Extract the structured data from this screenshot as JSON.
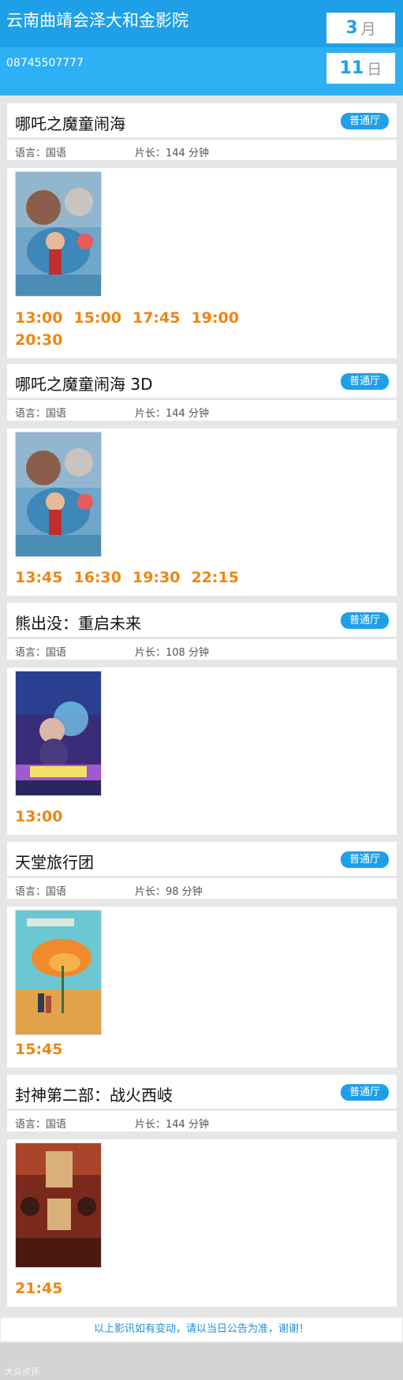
{
  "header": {
    "cinema_name": "云南曲靖会泽大和金影院",
    "phone": "08745507777",
    "month_num": "3",
    "month_unit": "月",
    "day_num": "11",
    "day_unit": "日"
  },
  "movies": [
    {
      "title": "哪吒之魔童闹海",
      "hall": "普通厅",
      "language": "语言：国语",
      "duration": "片长：144 分钟",
      "poster": "nezha-poster",
      "times": [
        "13:00",
        "15:00",
        "17:45",
        "19:00",
        "20:30"
      ]
    },
    {
      "title": "哪吒之魔童闹海 3D",
      "hall": "普通厅",
      "language": "语言：国语",
      "duration": "片长：144 分钟",
      "poster": "nezha-poster",
      "times": [
        "13:45",
        "16:30",
        "19:30",
        "22:15"
      ]
    },
    {
      "title": "熊出没：重启未来",
      "hall": "普通厅",
      "language": "语言：国语",
      "duration": "片长：108 分钟",
      "poster": "boonie-bears-poster",
      "times": [
        "13:00"
      ]
    },
    {
      "title": "天堂旅行团",
      "hall": "普通厅",
      "language": "语言：国语",
      "duration": "片长：98 分钟",
      "poster": "paradise-tour-poster",
      "times": [
        "15:45"
      ]
    },
    {
      "title": "封神第二部：战火西岐",
      "hall": "普通厅",
      "language": "语言：国语",
      "duration": "片长：144 分钟",
      "poster": "creation-of-gods-poster",
      "times": [
        "21:45"
      ]
    }
  ],
  "notice": "以上影讯如有变动，请以当日公告为准，谢谢！",
  "watermark": "大众点评"
}
